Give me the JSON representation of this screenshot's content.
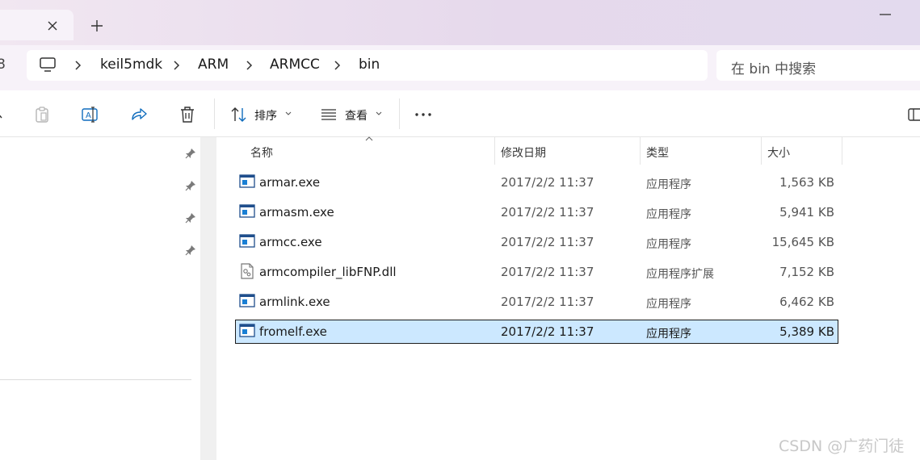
{
  "tabs": {
    "close_glyph": "×",
    "new_glyph": "+"
  },
  "address": {
    "edge_glyph": "8",
    "crumbs": [
      "keil5mdk",
      "ARM",
      "ARMCC",
      "bin"
    ]
  },
  "search": {
    "placeholder": "在 bin 中搜索"
  },
  "toolbar": {
    "sort_label": "排序",
    "view_label": "查看",
    "more_glyph": "···"
  },
  "columns": {
    "name": "名称",
    "date": "修改日期",
    "type": "类型",
    "size": "大小"
  },
  "files": [
    {
      "name": "armar.exe",
      "date": "2017/2/2 11:37",
      "type": "应用程序",
      "size": "1,563 KB",
      "icon": "exe-icon"
    },
    {
      "name": "armasm.exe",
      "date": "2017/2/2 11:37",
      "type": "应用程序",
      "size": "5,941 KB",
      "icon": "exe-icon"
    },
    {
      "name": "armcc.exe",
      "date": "2017/2/2 11:37",
      "type": "应用程序",
      "size": "15,645 KB",
      "icon": "exe-icon"
    },
    {
      "name": "armcompiler_libFNP.dll",
      "date": "2017/2/2 11:37",
      "type": "应用程序扩展",
      "size": "7,152 KB",
      "icon": "dll-icon"
    },
    {
      "name": "armlink.exe",
      "date": "2017/2/2 11:37",
      "type": "应用程序",
      "size": "6,462 KB",
      "icon": "exe-icon"
    },
    {
      "name": "fromelf.exe",
      "date": "2017/2/2 11:37",
      "type": "应用程序",
      "size": "5,389 KB",
      "icon": "exe-icon",
      "selected": true
    }
  ],
  "watermark": "CSDN @广药门徒",
  "colors": {
    "accent": "#0f6cbd",
    "selection": "#cce8ff",
    "title_gradient_start": "#f1e7f1",
    "title_gradient_end": "#e3daee"
  }
}
